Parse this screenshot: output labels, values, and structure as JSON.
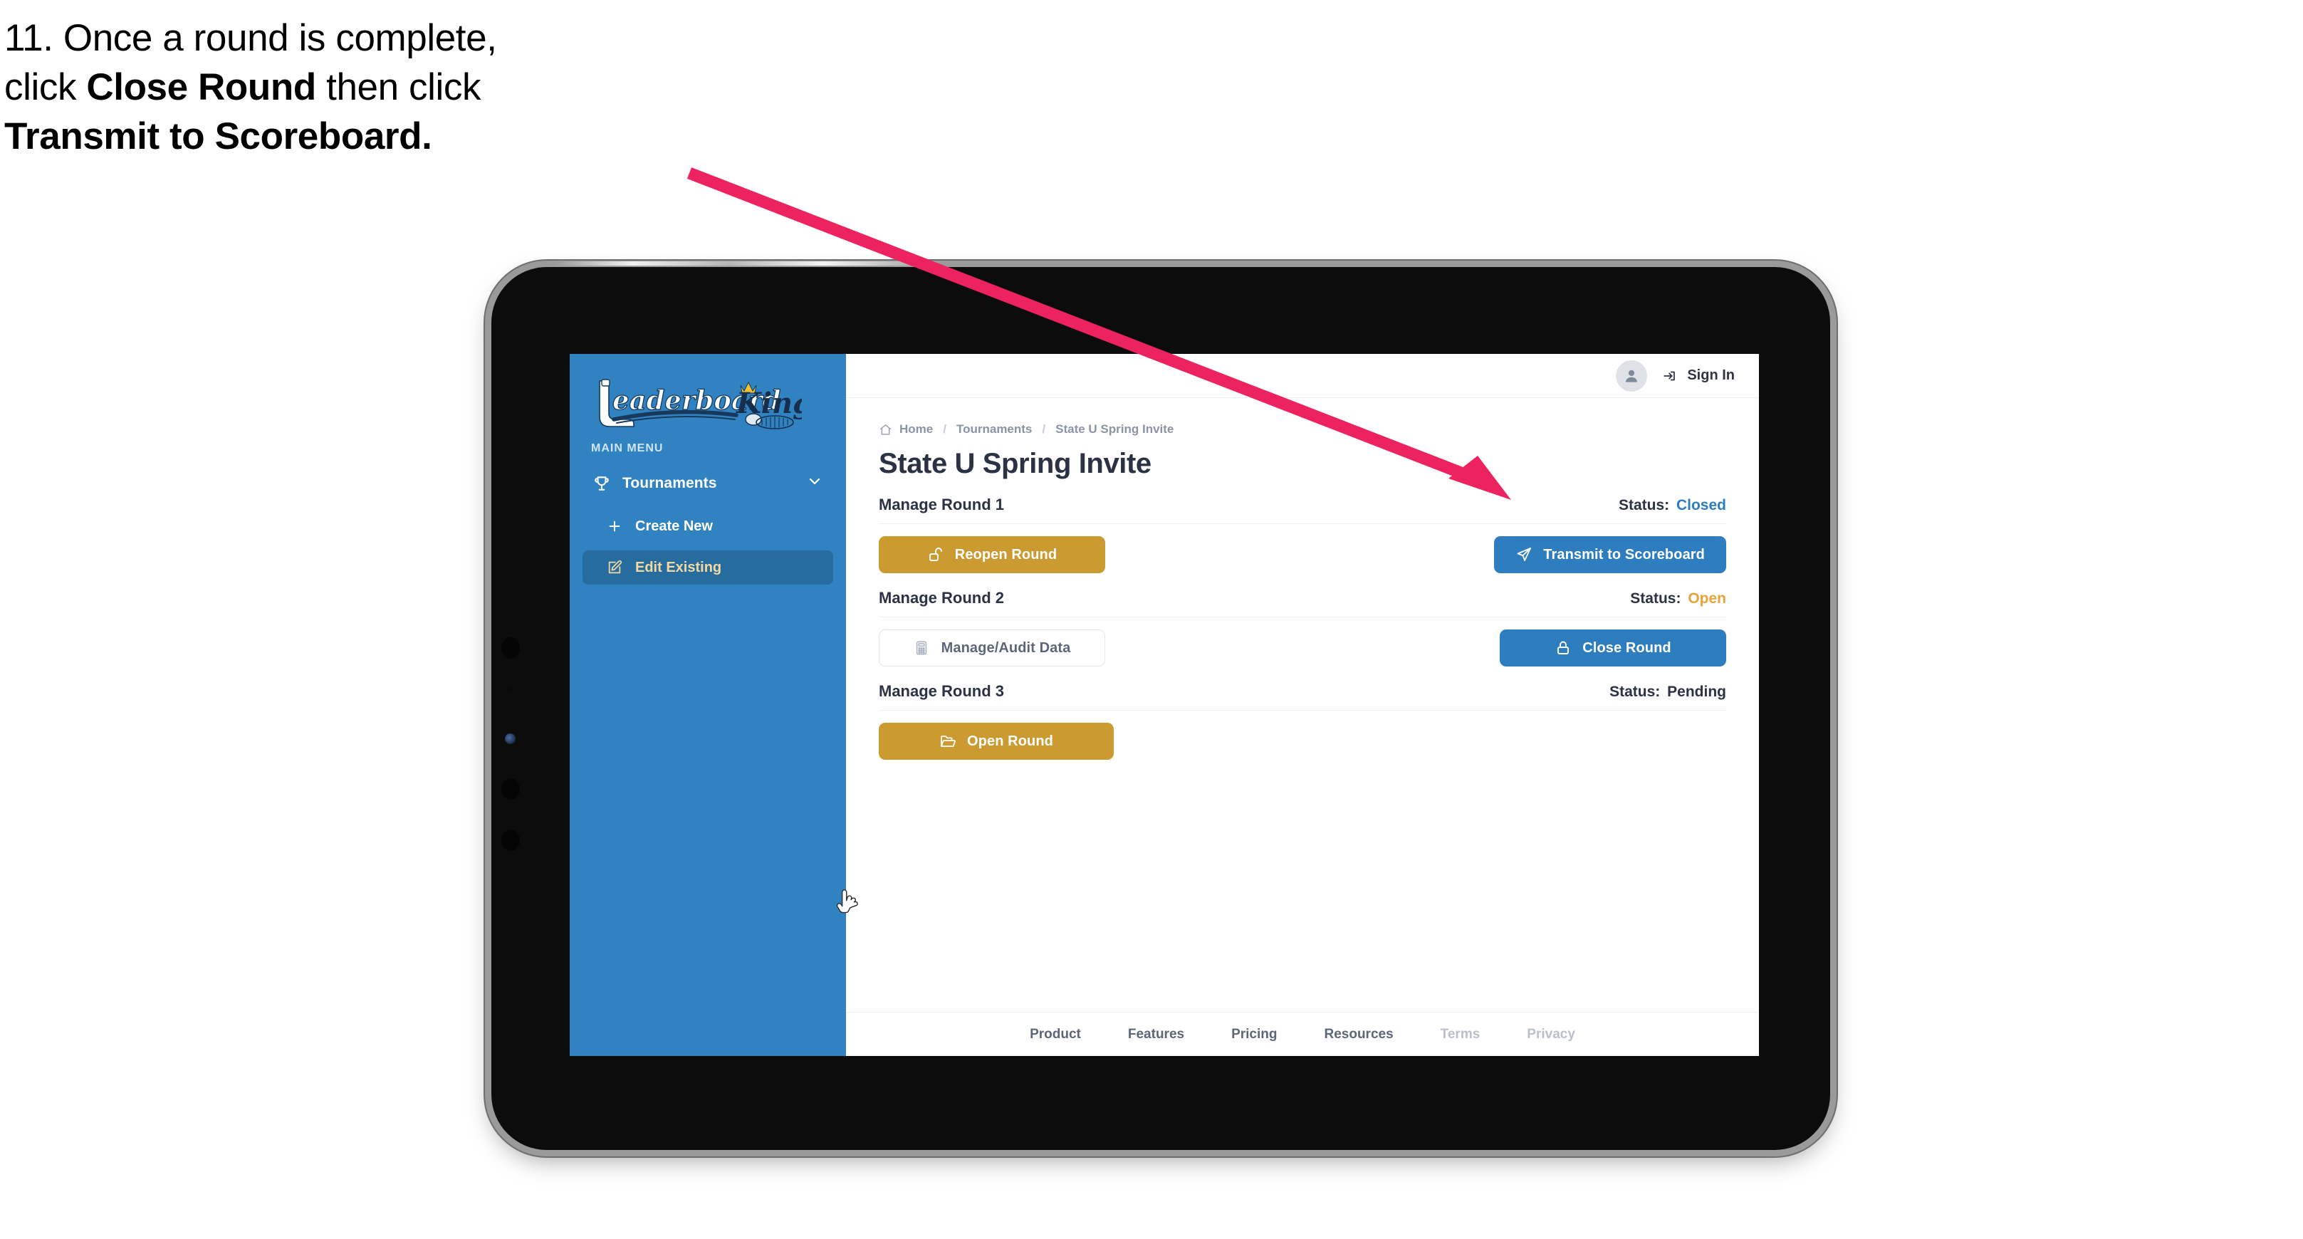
{
  "caption": {
    "line1": "11. Once a round is complete,",
    "line2_pre": "click ",
    "line2_bold": "Close Round",
    "line2_post": " then click",
    "line3_bold": "Transmit to Scoreboard."
  },
  "annotation": {
    "arrow_color": "#ED2360",
    "arrow_points_to": "transmit-to-scoreboard-button"
  },
  "app": {
    "sidebar": {
      "logo_primary": "Leaderboard",
      "logo_secondary": "King",
      "section_label": "MAIN MENU",
      "items": [
        {
          "label": "Tournaments",
          "icon": "trophy-icon",
          "expand_icon": "chevron-down-icon",
          "active": false
        },
        {
          "label": "Create New",
          "icon": "plus-icon",
          "active": false
        },
        {
          "label": "Edit Existing",
          "icon": "edit-square-icon",
          "active": true
        }
      ],
      "bg_color": "#3182C0",
      "active_bg_color": "#266C9F",
      "active_text_color": "#F3D9A0"
    },
    "topbar": {
      "avatar_icon": "user-avatar-icon",
      "signin_icon": "login-arrow-icon",
      "signin_label": "Sign In"
    },
    "breadcrumb": {
      "home_icon": "home-icon",
      "items": [
        "Home",
        "Tournaments",
        "State U Spring Invite"
      ],
      "separator": "/"
    },
    "page_title": "State U Spring Invite",
    "status_label": "Status:",
    "rounds": [
      {
        "name": "Manage Round 1",
        "status_value": "Closed",
        "status_color": "#2E7DBF",
        "left_button": {
          "label": "Reopen Round",
          "icon": "unlock-icon",
          "style": "gold"
        },
        "right_button": {
          "label": "Transmit to Scoreboard",
          "icon": "send-icon",
          "style": "blue"
        }
      },
      {
        "name": "Manage Round 2",
        "status_value": "Open",
        "status_color": "#E8A33D",
        "left_button": {
          "label": "Manage/Audit Data",
          "icon": "calculator-icon",
          "style": "ghost"
        },
        "right_button": {
          "label": "Close Round",
          "icon": "lock-icon",
          "style": "blue"
        }
      },
      {
        "name": "Manage Round 3",
        "status_value": "Pending",
        "status_color": "#2B3244",
        "left_button": {
          "label": "Open Round",
          "icon": "folder-open-icon",
          "style": "gold"
        },
        "right_button": null
      }
    ],
    "footer": {
      "links": [
        {
          "label": "Product",
          "muted": false
        },
        {
          "label": "Features",
          "muted": false
        },
        {
          "label": "Pricing",
          "muted": false
        },
        {
          "label": "Resources",
          "muted": false
        },
        {
          "label": "Terms",
          "muted": true
        },
        {
          "label": "Privacy",
          "muted": true
        }
      ]
    },
    "cursor": {
      "icon": "pointer-hand-cursor",
      "over": "edit-existing-item"
    }
  }
}
